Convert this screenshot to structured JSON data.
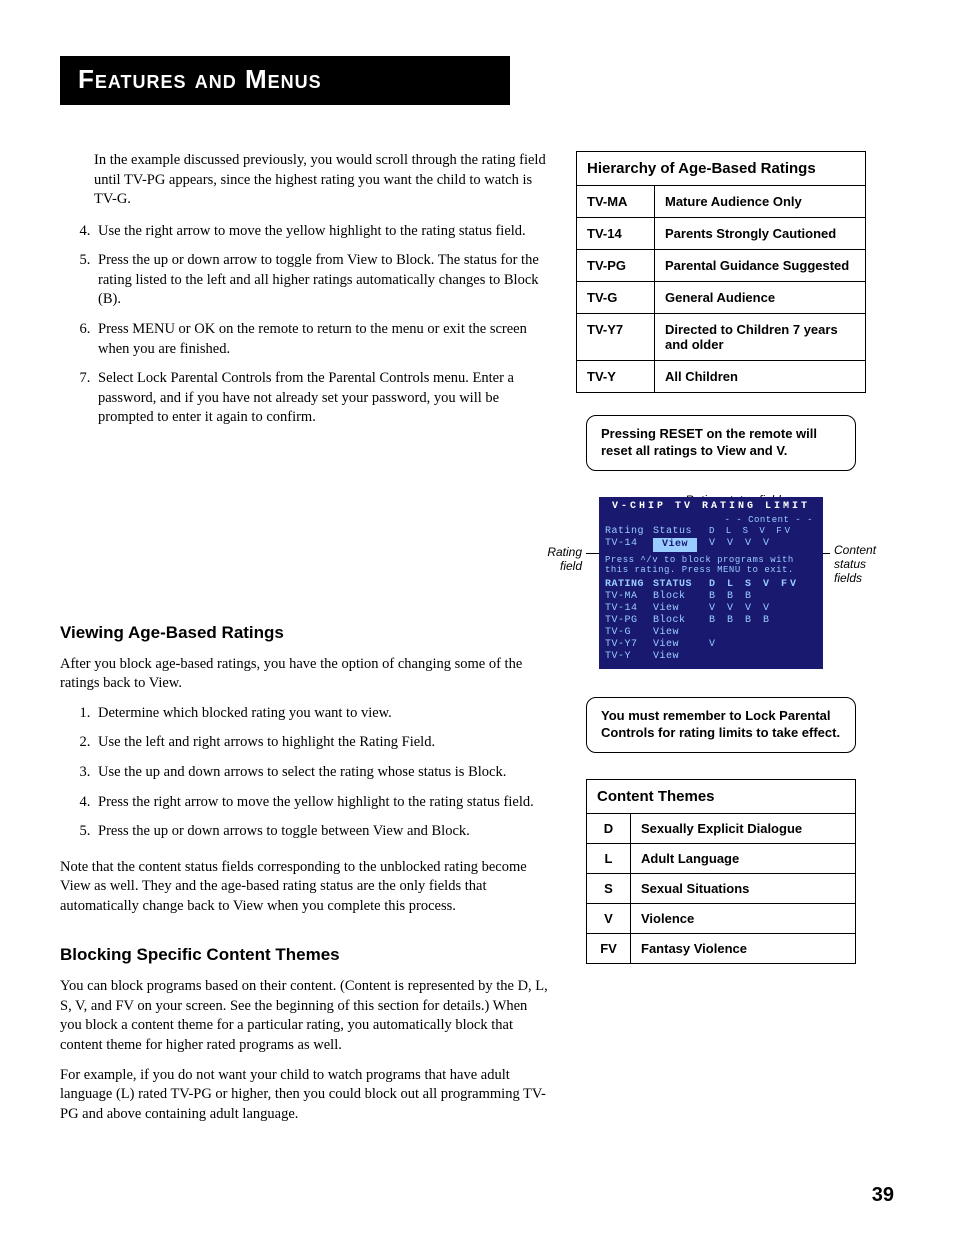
{
  "banner": "Features and Menus",
  "intro": "In the example discussed previously, you would scroll through the rating field until TV-PG appears, since the highest rating you want the child to watch is TV-G.",
  "steps_a": [
    "Use the right arrow to move the yellow highlight to the rating status field.",
    "Press the up or down arrow to toggle from View to Block. The status for the rating listed to the left and all higher ratings automatically changes to Block (B).",
    "Press MENU or OK on the remote to return to the menu or exit the screen when you are finished.",
    "Select Lock Parental Controls from the Parental Controls menu. Enter a password, and if you have not already set your password, you will be prompted to enter it again to confirm."
  ],
  "h_viewing": "Viewing Age-Based Ratings",
  "p_viewing": "After you block age-based ratings, you have the option of changing some of the ratings back to View.",
  "steps_b": [
    "Determine which blocked rating you want to view.",
    "Use the left and right arrows to highlight the Rating Field.",
    "Use the up and down arrows to select the rating whose status is Block.",
    "Press the right arrow to move the yellow highlight to the rating status field.",
    "Press the up or down arrows to toggle between View and Block."
  ],
  "p_note_viewing": "Note that the content status fields corresponding to the unblocked rating become View as well. They and the age-based rating status are the only fields that automatically change back to View when you complete this process.",
  "h_blocking": "Blocking Specific Content Themes",
  "p_block1": "You can block programs based on their content. (Content is represented by the D, L, S, V, and FV on your screen. See the beginning of this section for details.) When you block a content theme for a particular rating, you automatically block that content theme for higher rated programs as well.",
  "p_block2": "For example, if you do not want your child to watch programs that have adult language (L) rated TV-PG or higher, then you could block out all programming TV-PG and above containing adult language.",
  "hierarchy_title": "Hierarchy of Age-Based Ratings",
  "hierarchy": [
    {
      "code": "TV-MA",
      "desc": "Mature Audience Only"
    },
    {
      "code": "TV-14",
      "desc": "Parents Strongly Cautioned"
    },
    {
      "code": "TV-PG",
      "desc": "Parental Guidance Suggested"
    },
    {
      "code": "TV-G",
      "desc": "General Audience"
    },
    {
      "code": "TV-Y7",
      "desc": "Directed to Children 7 years and older"
    },
    {
      "code": "TV-Y",
      "desc": "All Children"
    }
  ],
  "note_reset": "Pressing RESET on the remote will reset all ratings to View and V.",
  "note_lock": "You must remember to Lock Parental Controls for rating limits to take effect.",
  "diagram": {
    "lbl_top": "Rating status field",
    "lbl_left": "Rating field",
    "lbl_right": "Content status fields",
    "title": "V-CHIP  TV  RATING  LIMIT",
    "content_hdr": "- - Content - -",
    "hdr_rating": "Rating",
    "hdr_status": "Status",
    "hdr_flags": "D  L  S  V  FV",
    "sel_rating": "TV-14",
    "sel_status": "View",
    "sel_flags": "V  V  V  V",
    "msg": "Press ^/v to block programs with this rating. Press MENU to exit.",
    "cols_hdr_rating": "RATING",
    "cols_hdr_status": "STATUS",
    "cols_hdr_flags": "D  L  S  V  FV",
    "rows": [
      {
        "r": "TV-MA",
        "s": "Block",
        "f": "      B  B  B"
      },
      {
        "r": "TV-14",
        "s": "View",
        "f": "V  V  V  V"
      },
      {
        "r": "TV-PG",
        "s": "Block",
        "f": "B  B  B  B"
      },
      {
        "r": "TV-G",
        "s": "View",
        "f": ""
      },
      {
        "r": "TV-Y7",
        "s": "View",
        "f": "            V"
      },
      {
        "r": "TV-Y",
        "s": "View",
        "f": ""
      }
    ]
  },
  "themes_title": "Content Themes",
  "themes": [
    {
      "code": "D",
      "desc": "Sexually Explicit Dialogue"
    },
    {
      "code": "L",
      "desc": "Adult Language"
    },
    {
      "code": "S",
      "desc": "Sexual Situations"
    },
    {
      "code": "V",
      "desc": "Violence"
    },
    {
      "code": "FV",
      "desc": "Fantasy Violence"
    }
  ],
  "page": "39"
}
